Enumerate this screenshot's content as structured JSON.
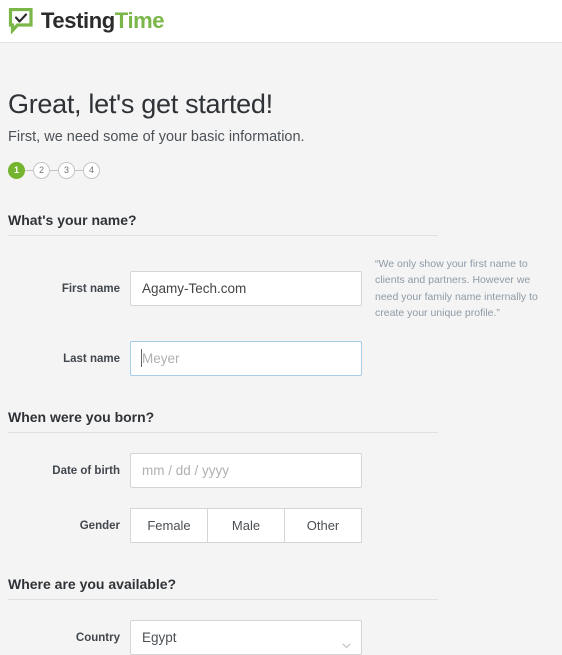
{
  "header": {
    "logo_icon": "speech-bubble-check-icon",
    "logo_text_primary": "Testing",
    "logo_text_secondary": "Time",
    "brand_green": "#7ab648",
    "brand_dark": "#2b2b2b"
  },
  "intro": {
    "title": "Great, let's get started!",
    "subtitle": "First, we need some of your basic information."
  },
  "steps": {
    "items": [
      {
        "label": "1",
        "state": "active"
      },
      {
        "label": "2",
        "state": "inactive"
      },
      {
        "label": "3",
        "state": "inactive"
      },
      {
        "label": "4",
        "state": "inactive"
      }
    ],
    "active_color": "#74b42e"
  },
  "sections": {
    "name": {
      "heading": "What's your name?",
      "first_name": {
        "label": "First name",
        "value": "Agamy-Tech.com",
        "placeholder": ""
      },
      "last_name": {
        "label": "Last name",
        "value": "",
        "placeholder": "Meyer",
        "focused": true,
        "focus_border_color": "#a8cde9"
      },
      "help_note": "“We only show your first name to clients and partners. However we need your family name internally to create your unique profile.”"
    },
    "birth": {
      "heading": "When were you born?",
      "date_of_birth": {
        "label": "Date of birth",
        "value": "",
        "placeholder": "mm / dd / yyyy"
      },
      "gender": {
        "label": "Gender",
        "options": [
          "Female",
          "Male",
          "Other"
        ],
        "selected": ""
      }
    },
    "availability": {
      "heading": "Where are you available?",
      "country": {
        "label": "Country",
        "value": "Egypt",
        "chevron_icon": "chevron-down-icon"
      }
    }
  }
}
